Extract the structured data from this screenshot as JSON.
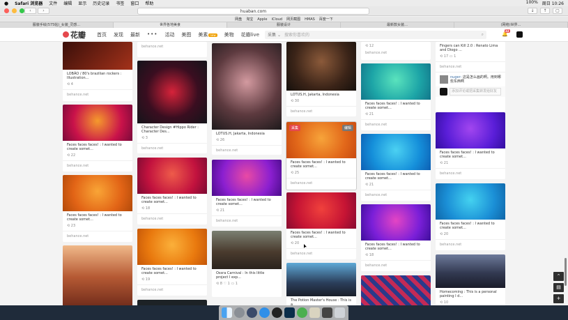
{
  "menubar": {
    "apple": "",
    "items": [
      "Safari 浏览器",
      "文件",
      "编辑",
      "显示",
      "历史记录",
      "书签",
      "窗口",
      "帮助"
    ],
    "status": "100%",
    "time": "周日 10:26"
  },
  "browser": {
    "url": "huaban.com",
    "back": "‹",
    "forward": "›"
  },
  "favorites": [
    "网盘",
    "淘宝",
    "Apple",
    "iCloud",
    "网页截图",
    "HMAS",
    "百度一下"
  ],
  "tabs": [
    "服装手绘(575帖)_女装_灵感…",
    "世界各地美食",
    "服装设计",
    "最新款女装…",
    "(网络)世界…"
  ],
  "site": {
    "logo": "花瓣",
    "nav": [
      "首页",
      "发现",
      "最新",
      "•••",
      "活动",
      "美图",
      "美素",
      "美物",
      "花瓣live"
    ],
    "badge_new": "new",
    "search_dropdown": "采集",
    "search_placeholder": "搜索你喜欢的",
    "notifications": "32"
  },
  "pins": {
    "c1_1": {
      "title": "LOBÃO / 80's brazilian rockers : Illustration...",
      "stats": "4",
      "src": "behance.net"
    },
    "c1_2": {
      "title": "Faces faces faces! : I wanted to create somet...",
      "stats": "22",
      "src": "behance.net"
    },
    "c1_3": {
      "title": "Faces faces faces! : I wanted to create somet...",
      "stats": "23",
      "src": "behance.net"
    },
    "c2_0": {
      "src": "behance.net"
    },
    "c2_1": {
      "title": "Character Design #Hippo Rider : Character Des...",
      "stats": "3",
      "src": "behance.net"
    },
    "c2_2": {
      "title": "Faces faces faces! : I wanted to create somet...",
      "stats": "18",
      "src": "behance.net"
    },
    "c2_3": {
      "title": "Faces faces faces! : I wanted to create somet...",
      "stats": "19",
      "src": "behance.net"
    },
    "c3_1": {
      "title": "LOTUS.H, Jakarta, Indonesia",
      "stats": "26",
      "src": "behance.net"
    },
    "c3_2": {
      "title": "Faces faces faces! : I wanted to create somet...",
      "stats": "21",
      "src": "behance.net"
    },
    "c3_3": {
      "title": "Ossra Carnival : In this little project I exp...",
      "stats": "8",
      "stats2": "1",
      "stats3": "1"
    },
    "c4_1": {
      "title": "LOTUS.H, Jakarta, Indonesia",
      "stats": "30",
      "src": "behance.net"
    },
    "c4_2": {
      "title": "Faces faces faces! : I wanted to create somet...",
      "stats": "25",
      "src": "behance.net",
      "tag_left": "采集",
      "tag_right": "编辑"
    },
    "c4_3": {
      "title": "Faces faces faces! : I wanted to create somet...",
      "stats": "20",
      "src": "behance.net"
    },
    "c4_4": {
      "title": "The Potion Master's House : This is a"
    },
    "c5_0": {
      "stats": "12",
      "src": "behance.net"
    },
    "c5_1": {
      "title": "Faces faces faces! : I wanted to create somet...",
      "stats": "21",
      "src": "behance.net"
    },
    "c5_2": {
      "title": "Faces faces faces! : I wanted to create somet...",
      "stats": "21",
      "src": "behance.net"
    },
    "c5_3": {
      "title": "Faces faces faces! : I wanted to create somet...",
      "stats": "18",
      "src": "behance.net"
    },
    "c6_0": {
      "title": "Fingers can Kill 2.0 : Renato Lima and Diogo ...",
      "stats": "17",
      "stats2": "1",
      "src": "behance.net"
    },
    "c6_user": {
      "name": "nuger:",
      "text": "这是怎么画的啊。用到哪些东西啊"
    },
    "c6_comment": {
      "placeholder": "添加评论或把采集转发给好友"
    },
    "c6_1": {
      "title": "Faces faces faces! : I wanted to create somet...",
      "stats": "21",
      "src": "behance.net"
    },
    "c6_2": {
      "title": "Faces faces faces! : I wanted to create somet...",
      "stats": "20",
      "src": "behance.net"
    },
    "c6_3": {
      "title": "Homecoming : This is a personal painting I d...",
      "stats": "10"
    }
  },
  "colors": {
    "brand": "#e5484d",
    "page_bg": "#f3f3f3"
  }
}
